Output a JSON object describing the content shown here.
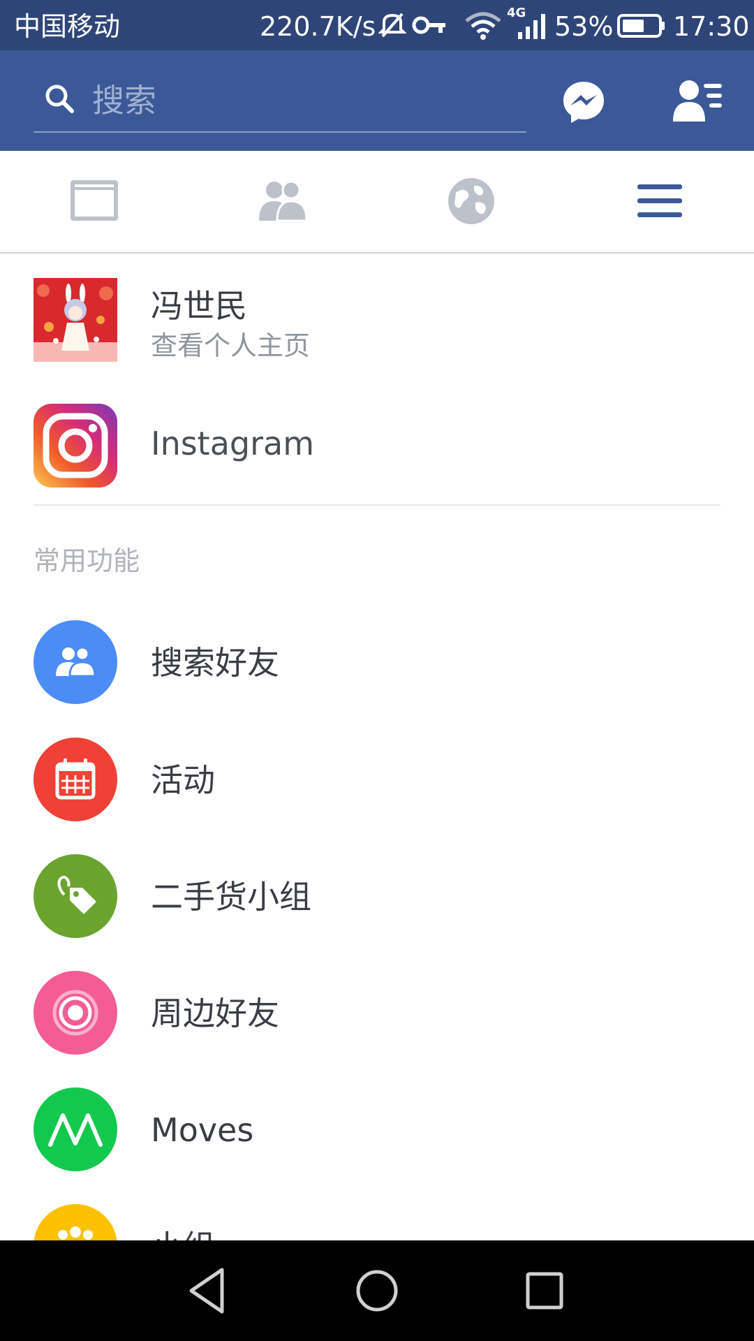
{
  "status_bar": {
    "carrier": "中国移动",
    "net_speed": "220.7K/s",
    "network_type": "4G",
    "battery": "53%",
    "time": "17:30"
  },
  "header": {
    "search_placeholder": "搜索",
    "icons": [
      "search-icon",
      "messenger-icon",
      "friend-requests-icon"
    ]
  },
  "tabs": [
    {
      "name": "news-feed",
      "icon": "news-feed-icon"
    },
    {
      "name": "friends",
      "icon": "friends-icon"
    },
    {
      "name": "notifications",
      "icon": "globe-icon"
    },
    {
      "name": "menu",
      "icon": "menu-icon",
      "active": true
    }
  ],
  "profile": {
    "name": "冯世民",
    "subtitle": "查看个人主页"
  },
  "instagram": {
    "label": "Instagram"
  },
  "section": {
    "title": "常用功能"
  },
  "items": [
    {
      "label": "搜索好友",
      "icon": "find-friends-icon",
      "color": "#4c8cf5"
    },
    {
      "label": "活动",
      "icon": "calendar-icon",
      "color": "#ef4136"
    },
    {
      "label": "二手货小组",
      "icon": "price-tag-icon",
      "color": "#6aa42f"
    },
    {
      "label": "周边好友",
      "icon": "nearby-icon",
      "color": "#f35d96"
    },
    {
      "label": "Moves",
      "icon": "moves-icon",
      "color": "#12c94e"
    },
    {
      "label": "小组",
      "icon": "groups-icon",
      "color": "#fbc100"
    }
  ],
  "colors": {
    "status_bar": "#2e4677",
    "app_bar": "#3b5998",
    "active_tab": "#3b5998",
    "inactive_tab": "#bdc1c9"
  }
}
